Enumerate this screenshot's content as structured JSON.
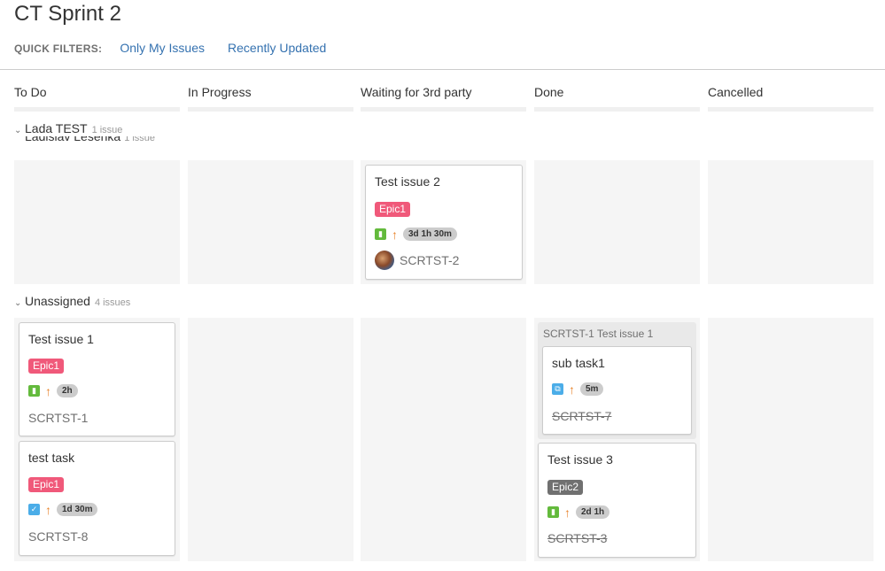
{
  "page": {
    "title": "CT Sprint 2"
  },
  "quick_filters": {
    "label": "QUICK FILTERS:",
    "items": [
      "Only My Issues",
      "Recently Updated"
    ]
  },
  "columns": [
    "To Do",
    "In Progress",
    "Waiting for 3rd party",
    "Done",
    "Cancelled"
  ],
  "swimlanes": [
    {
      "name": "Lada TEST",
      "count": "1 issue",
      "ghost_name": "Ladislav Lešenka",
      "ghost_count": "1 issue"
    },
    {
      "name": "Unassigned",
      "count": "4 issues"
    }
  ],
  "cards": {
    "scrtst2": {
      "summary": "Test issue 2",
      "epic": "Epic1",
      "estimate": "3d 1h 30m",
      "key": "SCRTST-2",
      "type_icon": "story-icon",
      "priority_icon": "priority-high-arrow-icon"
    },
    "scrtst1": {
      "summary": "Test issue 1",
      "epic": "Epic1",
      "estimate": "2h",
      "key": "SCRTST-1",
      "type_icon": "story-icon",
      "priority_icon": "priority-high-arrow-icon"
    },
    "scrtst8": {
      "summary": "test task",
      "epic": "Epic1",
      "estimate": "1d 30m",
      "key": "SCRTST-8",
      "type_icon": "task-checkbox-icon",
      "priority_icon": "priority-high-arrow-icon"
    },
    "scrtst7": {
      "parent_label": "SCRTST-1 Test issue 1",
      "summary": "sub task1",
      "estimate": "5m",
      "key": "SCRTST-7",
      "type_icon": "subtask-icon",
      "priority_icon": "priority-high-arrow-icon"
    },
    "scrtst3": {
      "summary": "Test issue 3",
      "epic": "Epic2",
      "estimate": "2d 1h",
      "key": "SCRTST-3",
      "type_icon": "story-icon",
      "priority_icon": "priority-high-arrow-icon"
    }
  },
  "colors": {
    "epic1": "#f0597a",
    "epic2": "#707070",
    "link": "#3572b0",
    "story": "#63ba3c",
    "task": "#4bade8",
    "priority": "#e8842c"
  }
}
